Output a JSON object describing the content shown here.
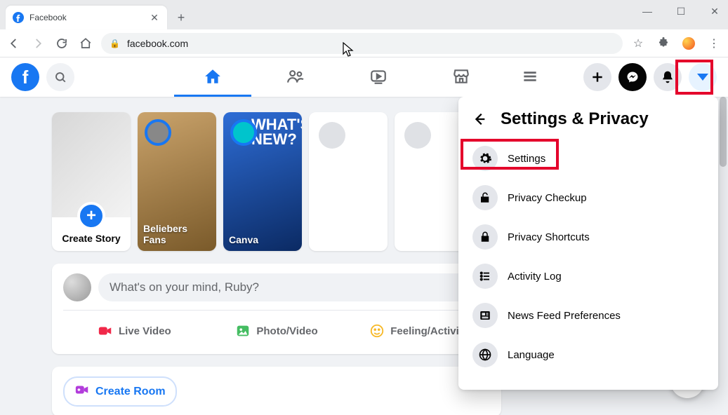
{
  "browser": {
    "tab_title": "Facebook",
    "url": "facebook.com"
  },
  "stories": [
    {
      "label": "Create Story"
    },
    {
      "label": "Beliebers Fans"
    },
    {
      "label": "Canva"
    }
  ],
  "composer": {
    "placeholder": "What's on your mind, Ruby?",
    "live_video": "Live Video",
    "photo_video": "Photo/Video",
    "feeling": "Feeling/Activity"
  },
  "rooms": {
    "create_room": "Create Room"
  },
  "dropdown": {
    "title": "Settings & Privacy",
    "items": [
      {
        "label": "Settings"
      },
      {
        "label": "Privacy Checkup"
      },
      {
        "label": "Privacy Shortcuts"
      },
      {
        "label": "Activity Log"
      },
      {
        "label": "News Feed Preferences"
      },
      {
        "label": "Language"
      }
    ]
  },
  "canva_overlay": "WHAT'S NEW?"
}
